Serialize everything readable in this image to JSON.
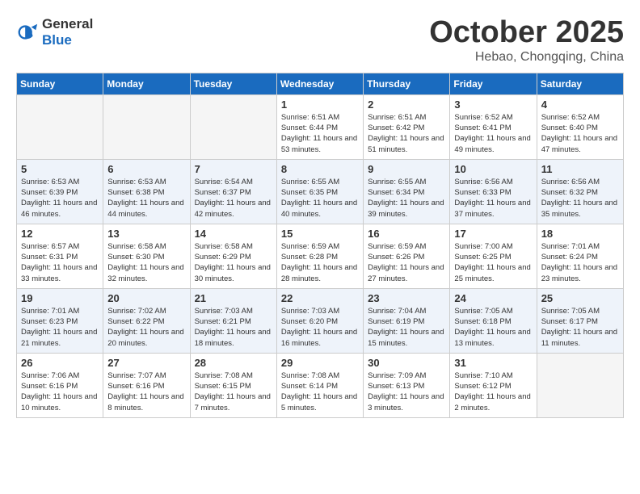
{
  "header": {
    "logo_general": "General",
    "logo_blue": "Blue",
    "title": "October 2025",
    "subtitle": "Hebao, Chongqing, China"
  },
  "weekdays": [
    "Sunday",
    "Monday",
    "Tuesday",
    "Wednesday",
    "Thursday",
    "Friday",
    "Saturday"
  ],
  "rows": [
    [
      {
        "empty": true
      },
      {
        "empty": true
      },
      {
        "empty": true
      },
      {
        "day": "1",
        "sunrise": "6:51 AM",
        "sunset": "6:44 PM",
        "daylight": "11 hours and 53 minutes."
      },
      {
        "day": "2",
        "sunrise": "6:51 AM",
        "sunset": "6:42 PM",
        "daylight": "11 hours and 51 minutes."
      },
      {
        "day": "3",
        "sunrise": "6:52 AM",
        "sunset": "6:41 PM",
        "daylight": "11 hours and 49 minutes."
      },
      {
        "day": "4",
        "sunrise": "6:52 AM",
        "sunset": "6:40 PM",
        "daylight": "11 hours and 47 minutes."
      }
    ],
    [
      {
        "day": "5",
        "sunrise": "6:53 AM",
        "sunset": "6:39 PM",
        "daylight": "11 hours and 46 minutes."
      },
      {
        "day": "6",
        "sunrise": "6:53 AM",
        "sunset": "6:38 PM",
        "daylight": "11 hours and 44 minutes."
      },
      {
        "day": "7",
        "sunrise": "6:54 AM",
        "sunset": "6:37 PM",
        "daylight": "11 hours and 42 minutes."
      },
      {
        "day": "8",
        "sunrise": "6:55 AM",
        "sunset": "6:35 PM",
        "daylight": "11 hours and 40 minutes."
      },
      {
        "day": "9",
        "sunrise": "6:55 AM",
        "sunset": "6:34 PM",
        "daylight": "11 hours and 39 minutes."
      },
      {
        "day": "10",
        "sunrise": "6:56 AM",
        "sunset": "6:33 PM",
        "daylight": "11 hours and 37 minutes."
      },
      {
        "day": "11",
        "sunrise": "6:56 AM",
        "sunset": "6:32 PM",
        "daylight": "11 hours and 35 minutes."
      }
    ],
    [
      {
        "day": "12",
        "sunrise": "6:57 AM",
        "sunset": "6:31 PM",
        "daylight": "11 hours and 33 minutes."
      },
      {
        "day": "13",
        "sunrise": "6:58 AM",
        "sunset": "6:30 PM",
        "daylight": "11 hours and 32 minutes."
      },
      {
        "day": "14",
        "sunrise": "6:58 AM",
        "sunset": "6:29 PM",
        "daylight": "11 hours and 30 minutes."
      },
      {
        "day": "15",
        "sunrise": "6:59 AM",
        "sunset": "6:28 PM",
        "daylight": "11 hours and 28 minutes."
      },
      {
        "day": "16",
        "sunrise": "6:59 AM",
        "sunset": "6:26 PM",
        "daylight": "11 hours and 27 minutes."
      },
      {
        "day": "17",
        "sunrise": "7:00 AM",
        "sunset": "6:25 PM",
        "daylight": "11 hours and 25 minutes."
      },
      {
        "day": "18",
        "sunrise": "7:01 AM",
        "sunset": "6:24 PM",
        "daylight": "11 hours and 23 minutes."
      }
    ],
    [
      {
        "day": "19",
        "sunrise": "7:01 AM",
        "sunset": "6:23 PM",
        "daylight": "11 hours and 21 minutes."
      },
      {
        "day": "20",
        "sunrise": "7:02 AM",
        "sunset": "6:22 PM",
        "daylight": "11 hours and 20 minutes."
      },
      {
        "day": "21",
        "sunrise": "7:03 AM",
        "sunset": "6:21 PM",
        "daylight": "11 hours and 18 minutes."
      },
      {
        "day": "22",
        "sunrise": "7:03 AM",
        "sunset": "6:20 PM",
        "daylight": "11 hours and 16 minutes."
      },
      {
        "day": "23",
        "sunrise": "7:04 AM",
        "sunset": "6:19 PM",
        "daylight": "11 hours and 15 minutes."
      },
      {
        "day": "24",
        "sunrise": "7:05 AM",
        "sunset": "6:18 PM",
        "daylight": "11 hours and 13 minutes."
      },
      {
        "day": "25",
        "sunrise": "7:05 AM",
        "sunset": "6:17 PM",
        "daylight": "11 hours and 11 minutes."
      }
    ],
    [
      {
        "day": "26",
        "sunrise": "7:06 AM",
        "sunset": "6:16 PM",
        "daylight": "11 hours and 10 minutes."
      },
      {
        "day": "27",
        "sunrise": "7:07 AM",
        "sunset": "6:16 PM",
        "daylight": "11 hours and 8 minutes."
      },
      {
        "day": "28",
        "sunrise": "7:08 AM",
        "sunset": "6:15 PM",
        "daylight": "11 hours and 7 minutes."
      },
      {
        "day": "29",
        "sunrise": "7:08 AM",
        "sunset": "6:14 PM",
        "daylight": "11 hours and 5 minutes."
      },
      {
        "day": "30",
        "sunrise": "7:09 AM",
        "sunset": "6:13 PM",
        "daylight": "11 hours and 3 minutes."
      },
      {
        "day": "31",
        "sunrise": "7:10 AM",
        "sunset": "6:12 PM",
        "daylight": "11 hours and 2 minutes."
      },
      {
        "empty": true
      }
    ]
  ],
  "labels": {
    "sunrise_prefix": "Sunrise: ",
    "sunset_prefix": "Sunset: ",
    "daylight_label": "Daylight: "
  }
}
